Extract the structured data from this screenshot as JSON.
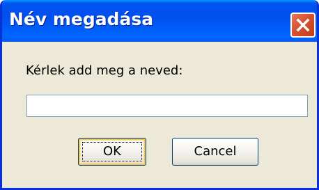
{
  "window": {
    "title": "Név megadása",
    "close_icon": "close-icon",
    "title_color": "#0053EE",
    "close_color": "#D8522F"
  },
  "dialog": {
    "prompt": "Kérlek add meg a neved:",
    "input_value": "",
    "ok_label": "OK",
    "cancel_label": "Cancel"
  }
}
